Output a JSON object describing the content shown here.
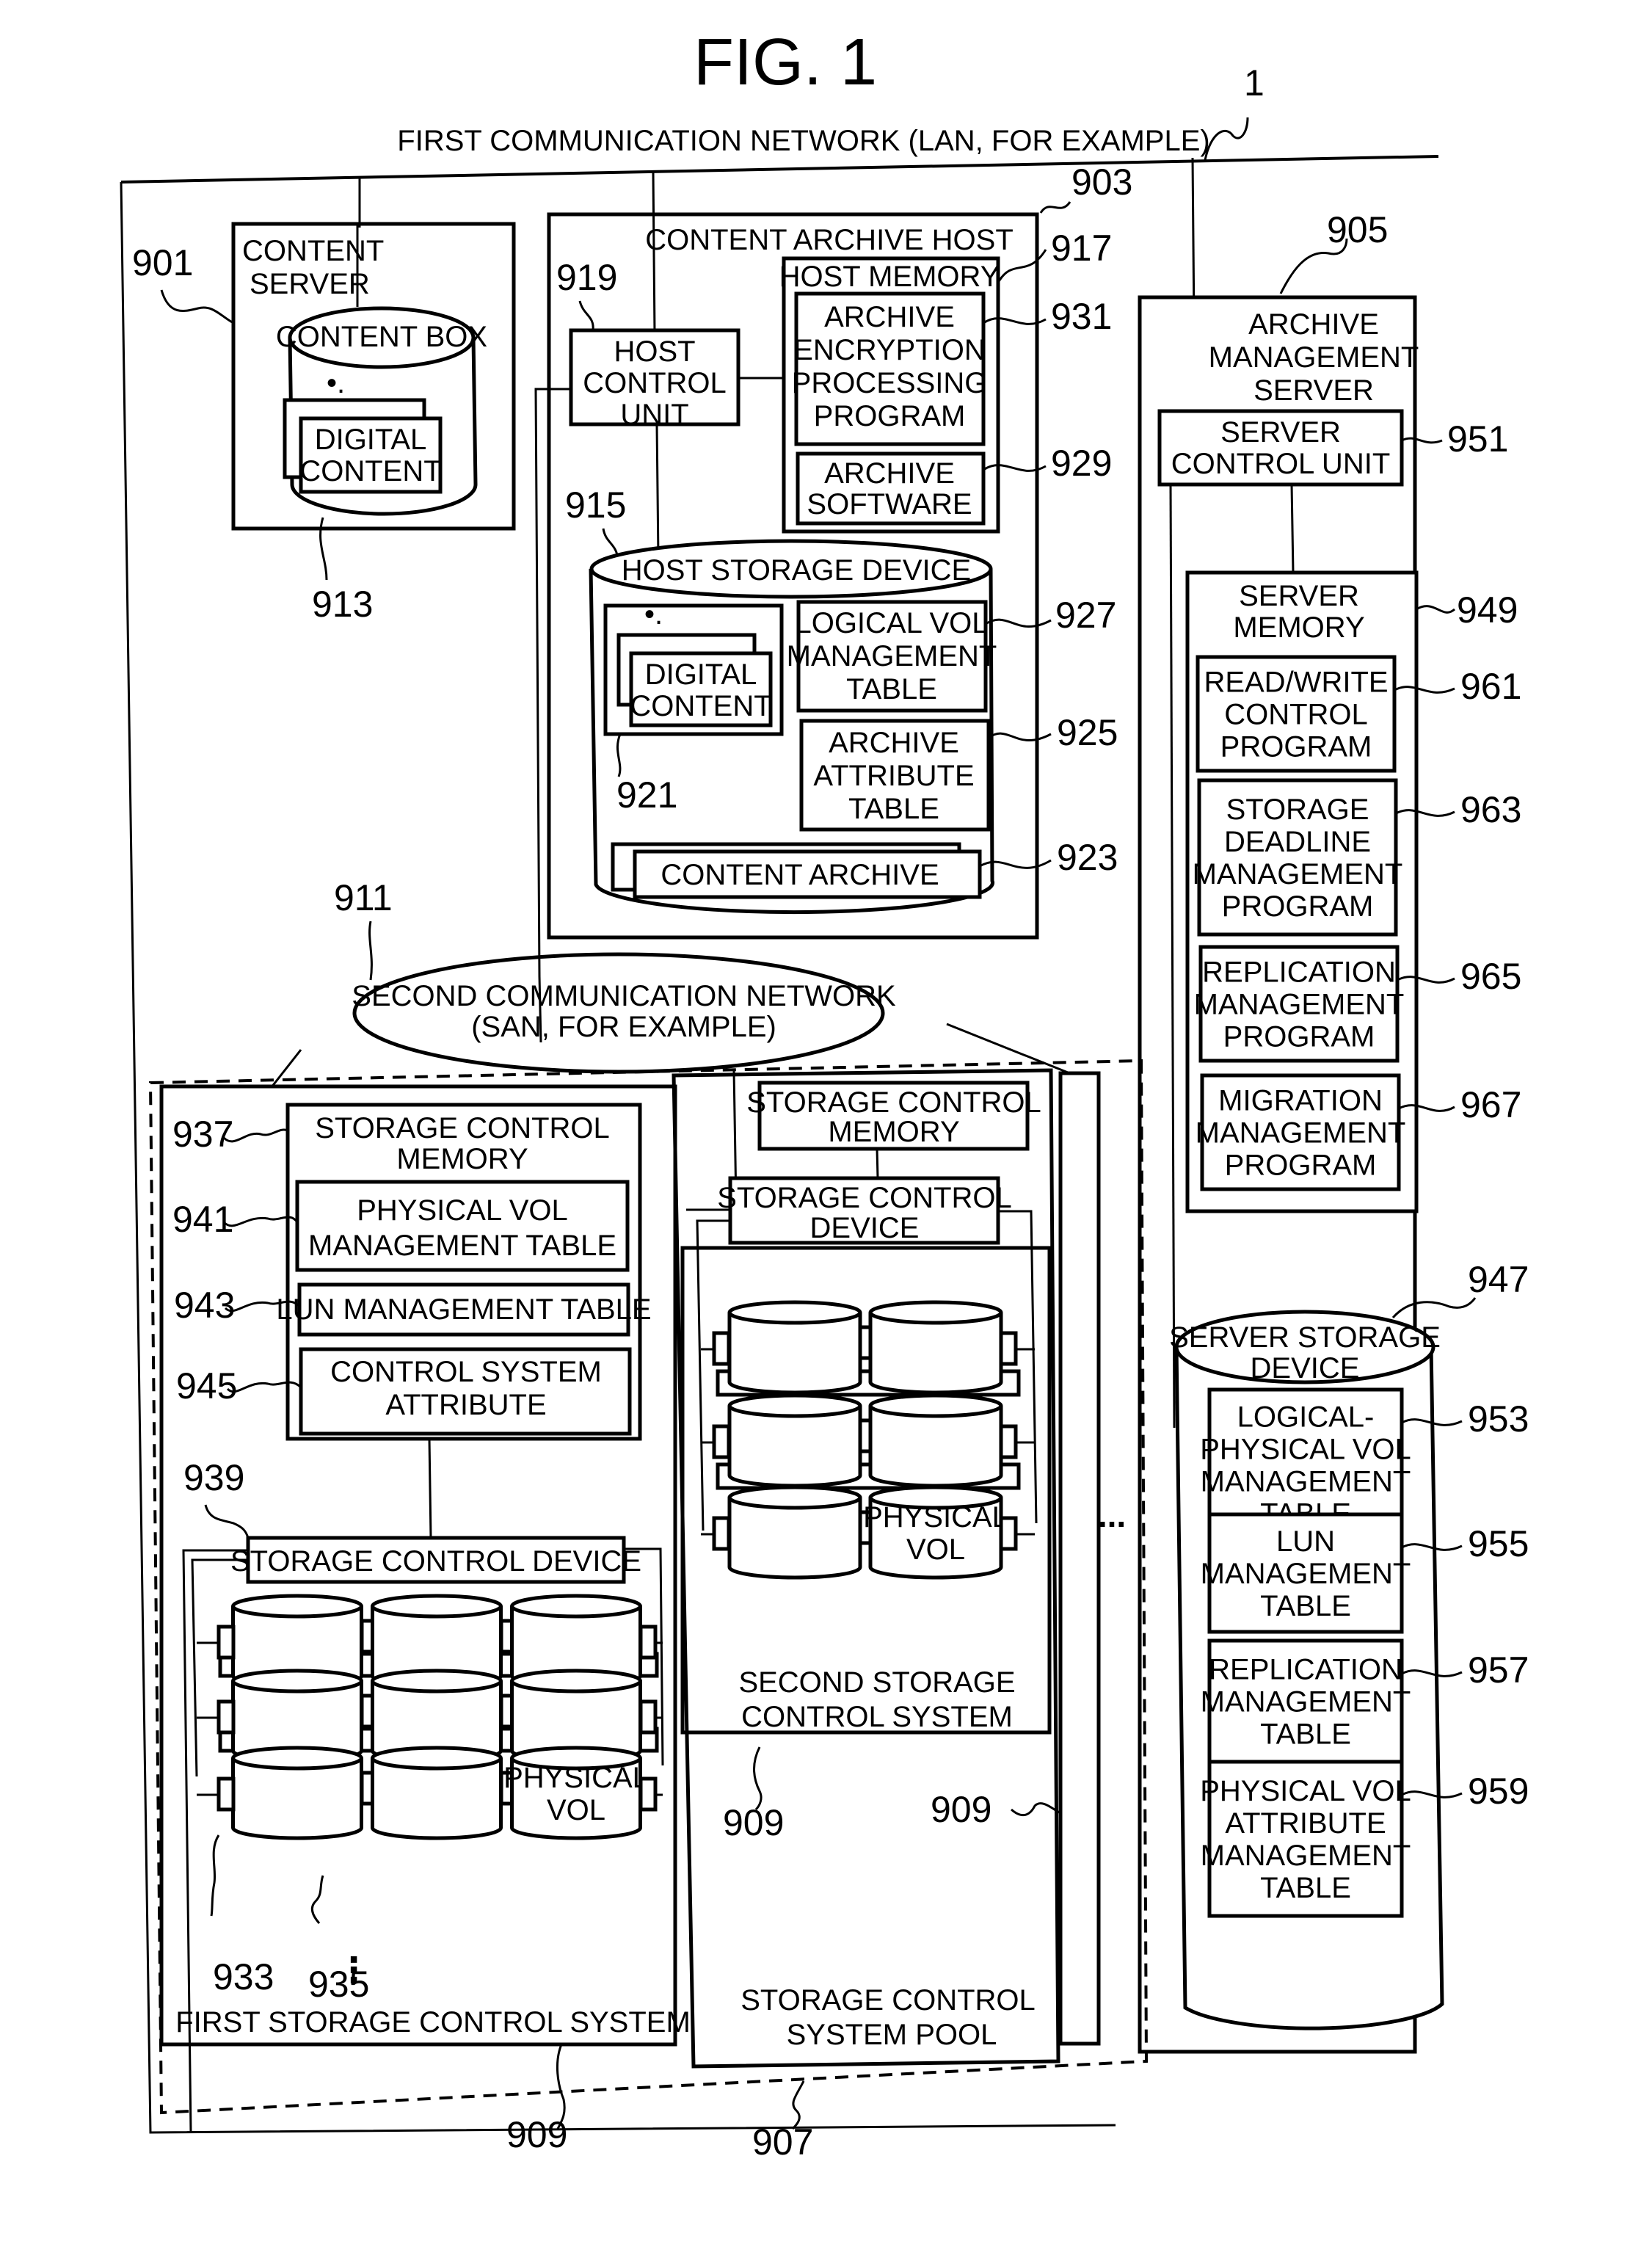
{
  "figure": {
    "title": "FIG. 1",
    "system_ref": "1"
  },
  "first_network": {
    "label": "FIRST COMMUNICATION NETWORK (LAN, FOR EXAMPLE)"
  },
  "content_server": {
    "ref": "901",
    "label": [
      "CONTENT",
      "SERVER"
    ],
    "content_box": {
      "label": "CONTENT BOX",
      "ref": "913"
    },
    "digital_content": [
      "DIGITAL",
      "CONTENT"
    ]
  },
  "content_archive_host": {
    "ref": "903",
    "label": "CONTENT ARCHIVE HOST",
    "host_control_unit": {
      "ref": "919",
      "label": [
        "HOST",
        "CONTROL",
        "UNIT"
      ]
    },
    "host_memory": {
      "ref": "917",
      "label": "HOST MEMORY",
      "items": [
        {
          "ref": "931",
          "label": [
            "ARCHIVE",
            "ENCRYPTION",
            "PROCESSING",
            "PROGRAM"
          ]
        },
        {
          "ref": "929",
          "label": [
            "ARCHIVE",
            "SOFTWARE"
          ]
        }
      ]
    },
    "host_storage_device": {
      "ref": "915",
      "label": "HOST STORAGE DEVICE",
      "digital_content": {
        "ref": "921",
        "label": [
          "DIGITAL",
          "CONTENT"
        ]
      },
      "items": [
        {
          "ref": "927",
          "label": [
            "LOGICAL VOL",
            "MANAGEMENT",
            "TABLE"
          ]
        },
        {
          "ref": "925",
          "label": [
            "ARCHIVE",
            "ATTRIBUTE",
            "TABLE"
          ]
        }
      ],
      "content_archive": {
        "ref": "923",
        "label": "CONTENT ARCHIVE"
      }
    }
  },
  "archive_management_server": {
    "ref": "905",
    "label": [
      "ARCHIVE",
      "MANAGEMENT",
      "SERVER"
    ],
    "server_control_unit": {
      "ref": "951",
      "label": [
        "SERVER",
        "CONTROL UNIT"
      ]
    },
    "server_memory": {
      "ref": "949",
      "label": [
        "SERVER",
        "MEMORY"
      ],
      "items": [
        {
          "ref": "961",
          "label": [
            "READ/WRITE",
            "CONTROL",
            "PROGRAM"
          ]
        },
        {
          "ref": "963",
          "label": [
            "STORAGE",
            "DEADLINE",
            "MANAGEMENT",
            "PROGRAM"
          ]
        },
        {
          "ref": "965",
          "label": [
            "REPLICATION",
            "MANAGEMENT",
            "PROGRAM"
          ]
        },
        {
          "ref": "967",
          "label": [
            "MIGRATION",
            "MANAGEMENT",
            "PROGRAM"
          ]
        }
      ]
    },
    "server_storage_device": {
      "ref": "947",
      "label": [
        "SERVER STORAGE",
        "DEVICE"
      ],
      "items": [
        {
          "ref": "953",
          "label": [
            "LOGICAL-",
            "PHYSICAL VOL",
            "MANAGEMENT",
            "TABLE"
          ]
        },
        {
          "ref": "955",
          "label": [
            "LUN",
            "MANAGEMENT",
            "TABLE"
          ]
        },
        {
          "ref": "957",
          "label": [
            "REPLICATION",
            "MANAGEMENT",
            "TABLE"
          ]
        },
        {
          "ref": "959",
          "label": [
            "PHYSICAL VOL",
            "ATTRIBUTE",
            "MANAGEMENT",
            "TABLE"
          ]
        }
      ]
    }
  },
  "second_network": {
    "ref": "911",
    "label": [
      "SECOND COMMUNICATION NETWORK",
      "(SAN, FOR EXAMPLE)"
    ]
  },
  "storage_pool": {
    "ref": "907",
    "label": [
      "STORAGE CONTROL",
      "SYSTEM POOL"
    ],
    "ellipsis": "..."
  },
  "first_storage_system": {
    "ref": "909",
    "label": "FIRST STORAGE CONTROL SYSTEM",
    "memory": {
      "ref": "937",
      "label": [
        "STORAGE CONTROL",
        "MEMORY"
      ],
      "items": [
        {
          "ref": "941",
          "label": [
            "PHYSICAL VOL",
            "MANAGEMENT TABLE"
          ]
        },
        {
          "ref": "943",
          "label": [
            "LUN MANAGEMENT TABLE"
          ]
        },
        {
          "ref": "945",
          "label": [
            "CONTROL SYSTEM",
            "ATTRIBUTE"
          ]
        }
      ]
    },
    "control_device": {
      "ref": "939",
      "label": "STORAGE CONTROL DEVICE"
    },
    "port_ref": "933",
    "disk_ref": "935",
    "physical_vol": [
      "PHYSICAL",
      "VOL"
    ],
    "more": "⋮"
  },
  "second_storage_system": {
    "ref": "909",
    "label": [
      "SECOND STORAGE",
      "CONTROL SYSTEM"
    ],
    "memory": {
      "label": [
        "STORAGE CONTROL",
        "MEMORY"
      ]
    },
    "control_device": {
      "label": [
        "STORAGE CONTROL",
        "DEVICE"
      ]
    },
    "physical_vol": [
      "PHYSICAL",
      "VOL"
    ]
  },
  "third_storage_system": {
    "ref": "909"
  }
}
